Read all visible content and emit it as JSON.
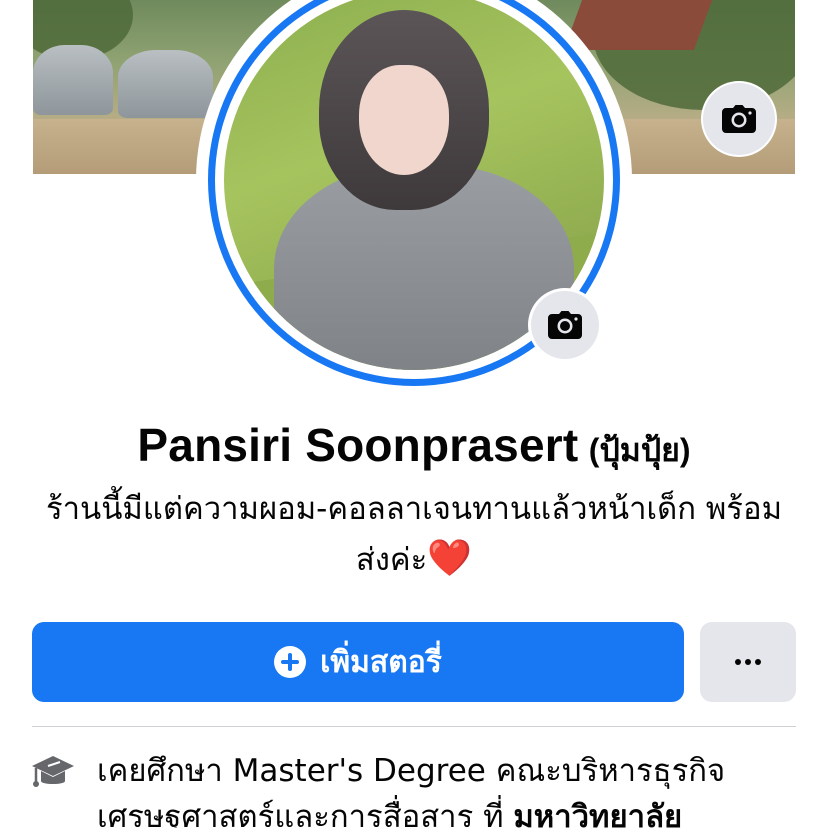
{
  "profile": {
    "name": "Pansiri Soonprasert",
    "alternate_name": "(ปุ้มปุ้ย)",
    "bio": "ร้านนี้มีแต่ความผอม-คอลลาเจนทานแล้วหน้าเด็ก พร้อมส่งค่ะ",
    "bio_emoji": "❤️"
  },
  "actions": {
    "add_story_label": "เพิ่มสตอรี่",
    "more_label": "..."
  },
  "education": {
    "prefix": "เคยศึกษา Master's Degree คณะบริหารธุรกิจเศรษฐศาสตร์และการสื่อสาร ที่",
    "school": "มหาวิทยาลัย"
  },
  "icons": {
    "cover_camera": "camera-icon",
    "profile_camera": "camera-icon",
    "add_story": "plus-circle-icon",
    "more": "more-dots-icon",
    "education": "graduation-cap-icon"
  },
  "colors": {
    "primary": "#1877f2",
    "secondary_button": "#e4e6eb",
    "text": "#050505",
    "divider": "#ced0d4",
    "heart": "#e02424"
  }
}
